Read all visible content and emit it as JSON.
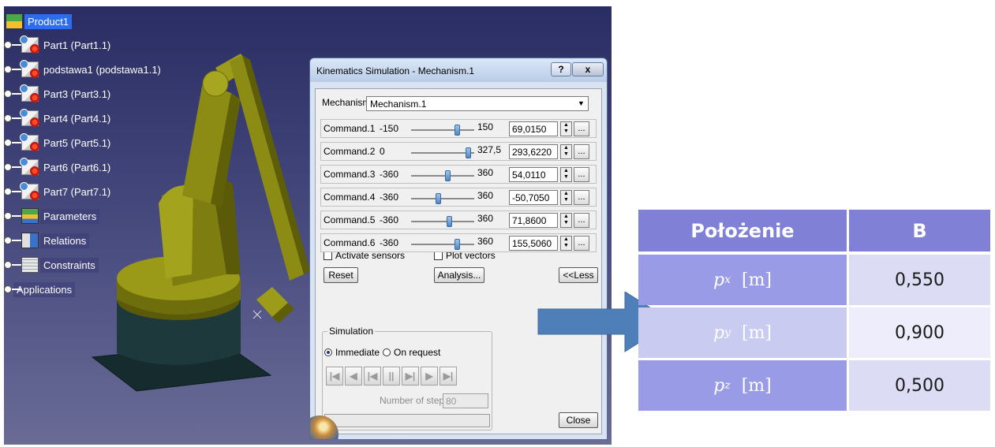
{
  "tree": {
    "items": [
      {
        "label": "Product1",
        "icon": "product-icon",
        "selected": true
      },
      {
        "label": "Part1 (Part1.1)",
        "icon": "part-icon"
      },
      {
        "label": "podstawa1 (podstawa1.1)",
        "icon": "part-icon"
      },
      {
        "label": "Part3 (Part3.1)",
        "icon": "part-icon"
      },
      {
        "label": "Part4 (Part4.1)",
        "icon": "part-icon"
      },
      {
        "label": "Part5 (Part5.1)",
        "icon": "part-icon"
      },
      {
        "label": "Part6 (Part6.1)",
        "icon": "part-icon"
      },
      {
        "label": "Part7 (Part7.1)",
        "icon": "part-icon"
      },
      {
        "label": "Parameters",
        "icon": "parameters-icon"
      },
      {
        "label": "Relations",
        "icon": "relations-icon"
      },
      {
        "label": "Constraints",
        "icon": "constraints-icon"
      },
      {
        "label": "Applications",
        "icon": "applications-icon"
      }
    ]
  },
  "dialog": {
    "title": "Kinematics Simulation - Mechanism.1",
    "help_label": "?",
    "close_x_label": "x",
    "mechanism_label": "Mechanism:",
    "mechanism_value": "Mechanism.1",
    "commands": [
      {
        "name": "Command.1",
        "min": "-150",
        "max": "150",
        "value": "69,0150",
        "slider_fraction": 0.73
      },
      {
        "name": "Command.2",
        "min": "0",
        "max": "327,5",
        "value": "293,6220",
        "slider_fraction": 0.9
      },
      {
        "name": "Command.3",
        "min": "-360",
        "max": "360",
        "value": "54,0110",
        "slider_fraction": 0.57
      },
      {
        "name": "Command.4",
        "min": "-360",
        "max": "360",
        "value": "-50,7050",
        "slider_fraction": 0.43
      },
      {
        "name": "Command.5",
        "min": "-360",
        "max": "360",
        "value": "71,8600",
        "slider_fraction": 0.6
      },
      {
        "name": "Command.6",
        "min": "-360",
        "max": "360",
        "value": "155,5060",
        "slider_fraction": 0.72
      }
    ],
    "activate_sensors_label": "Activate sensors",
    "plot_vectors_label": "Plot vectors",
    "reset_label": "Reset",
    "analysis_label": "Analysis...",
    "less_label": "<<Less",
    "simulation_label": "Simulation",
    "immediate_label": "Immediate",
    "on_request_label": "On request",
    "steps_label": "Number of steps:",
    "steps_value": "80",
    "close_label": "Close"
  },
  "table": {
    "header": [
      "Położenie",
      "B"
    ],
    "rows": [
      {
        "var": "p",
        "sub": "x",
        "unit": "[m]",
        "value": "0,550"
      },
      {
        "var": "p",
        "sub": "y",
        "unit": "[m]",
        "value": "0,900"
      },
      {
        "var": "p",
        "sub": "z",
        "unit": "[m]",
        "value": "0,500"
      }
    ]
  },
  "colors": {
    "table_header": "#7f80d6",
    "arrow": "#4f7fb8",
    "robot_yellow": "#8f8f12"
  }
}
